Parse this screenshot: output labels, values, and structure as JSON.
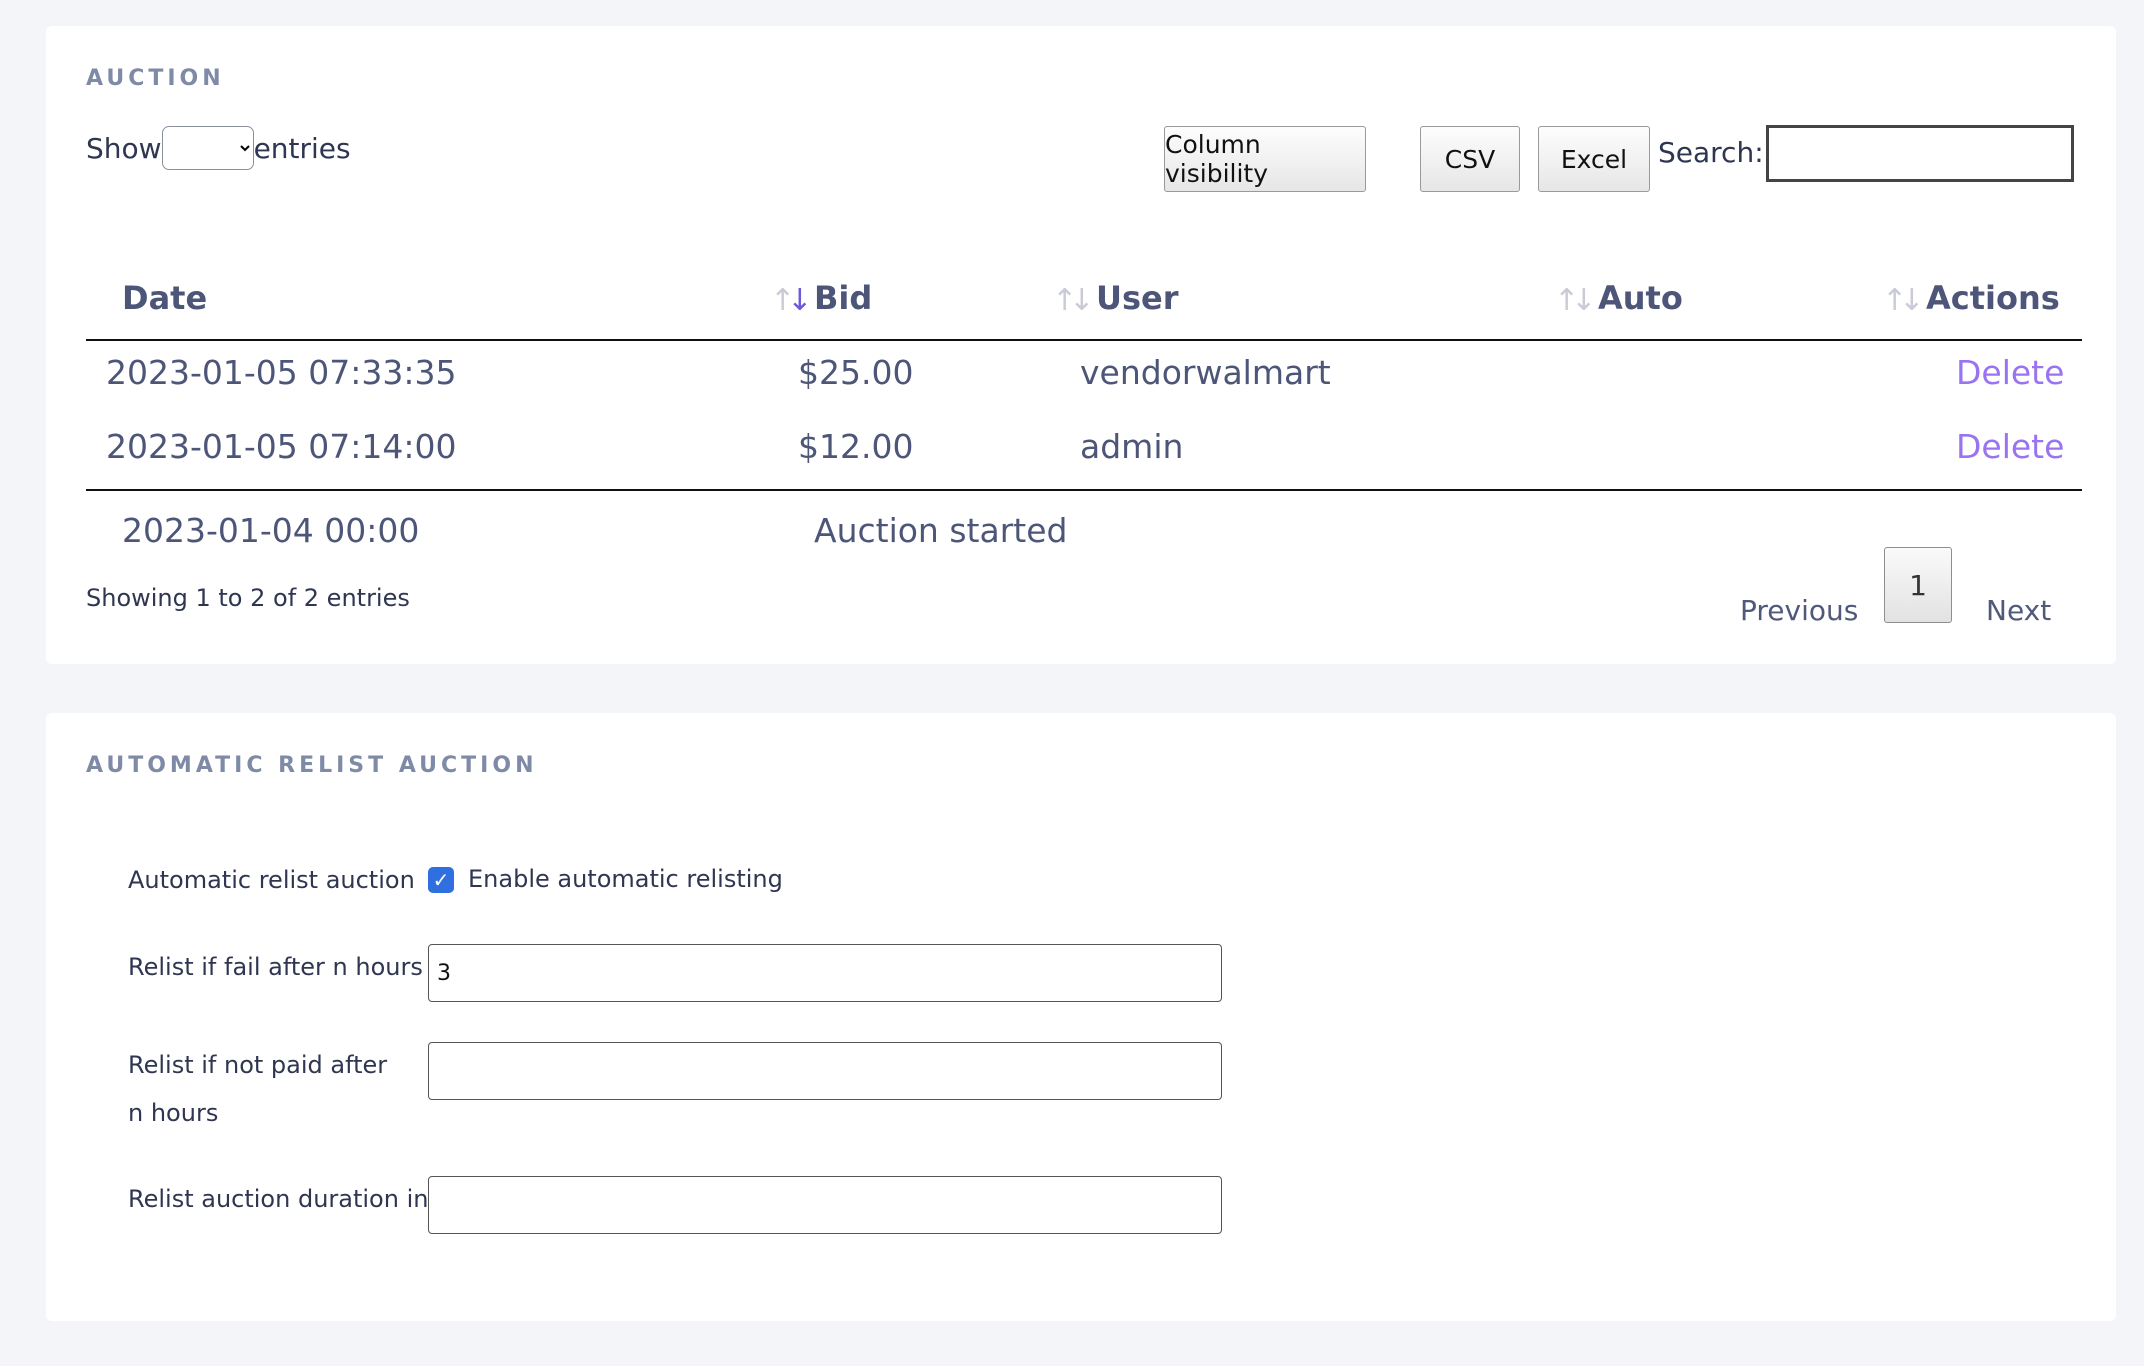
{
  "auction": {
    "title": "AUCTION",
    "length": {
      "prefix": "Show",
      "suffix": "entries",
      "selected": ""
    },
    "buttons": {
      "column_visibility": "Column visibility",
      "csv": "CSV",
      "excel": "Excel"
    },
    "search": {
      "label": "Search:",
      "value": ""
    },
    "columns": [
      "Date",
      "Bid",
      "User",
      "Auto",
      "Actions"
    ],
    "rows": [
      {
        "date": "2023-01-05 07:33:35",
        "bid": "$25.00",
        "user": "vendorwalmart",
        "auto": "",
        "action": "Delete"
      },
      {
        "date": "2023-01-05 07:14:00",
        "bid": "$12.00",
        "user": "admin",
        "auto": "",
        "action": "Delete"
      }
    ],
    "footer": {
      "date": "2023-01-04 00:00",
      "text": "Auction started"
    },
    "info": "Showing 1 to 2 of 2 entries",
    "pagination": {
      "previous": "Previous",
      "current": "1",
      "next": "Next"
    },
    "sort_icons": {
      "active": "sort-desc-icon",
      "inactive": "sort-both-icon"
    }
  },
  "relist": {
    "title": "AUTOMATIC RELIST AUCTION",
    "enable": {
      "label": "Automatic relist auction",
      "checkbox_label": "Enable automatic relisting",
      "checked": true
    },
    "fail_hours": {
      "label": "Relist if fail after n hours",
      "value": "3"
    },
    "not_paid_hours": {
      "label": "Relist if not paid after n hours",
      "value": ""
    },
    "duration": {
      "label": "Relist auction duration in h",
      "value": ""
    }
  },
  "colors": {
    "accent": "#9a74f0",
    "checkbox": "#2f6fe0",
    "title": "#7e8aa6",
    "text": "#4d5678"
  }
}
